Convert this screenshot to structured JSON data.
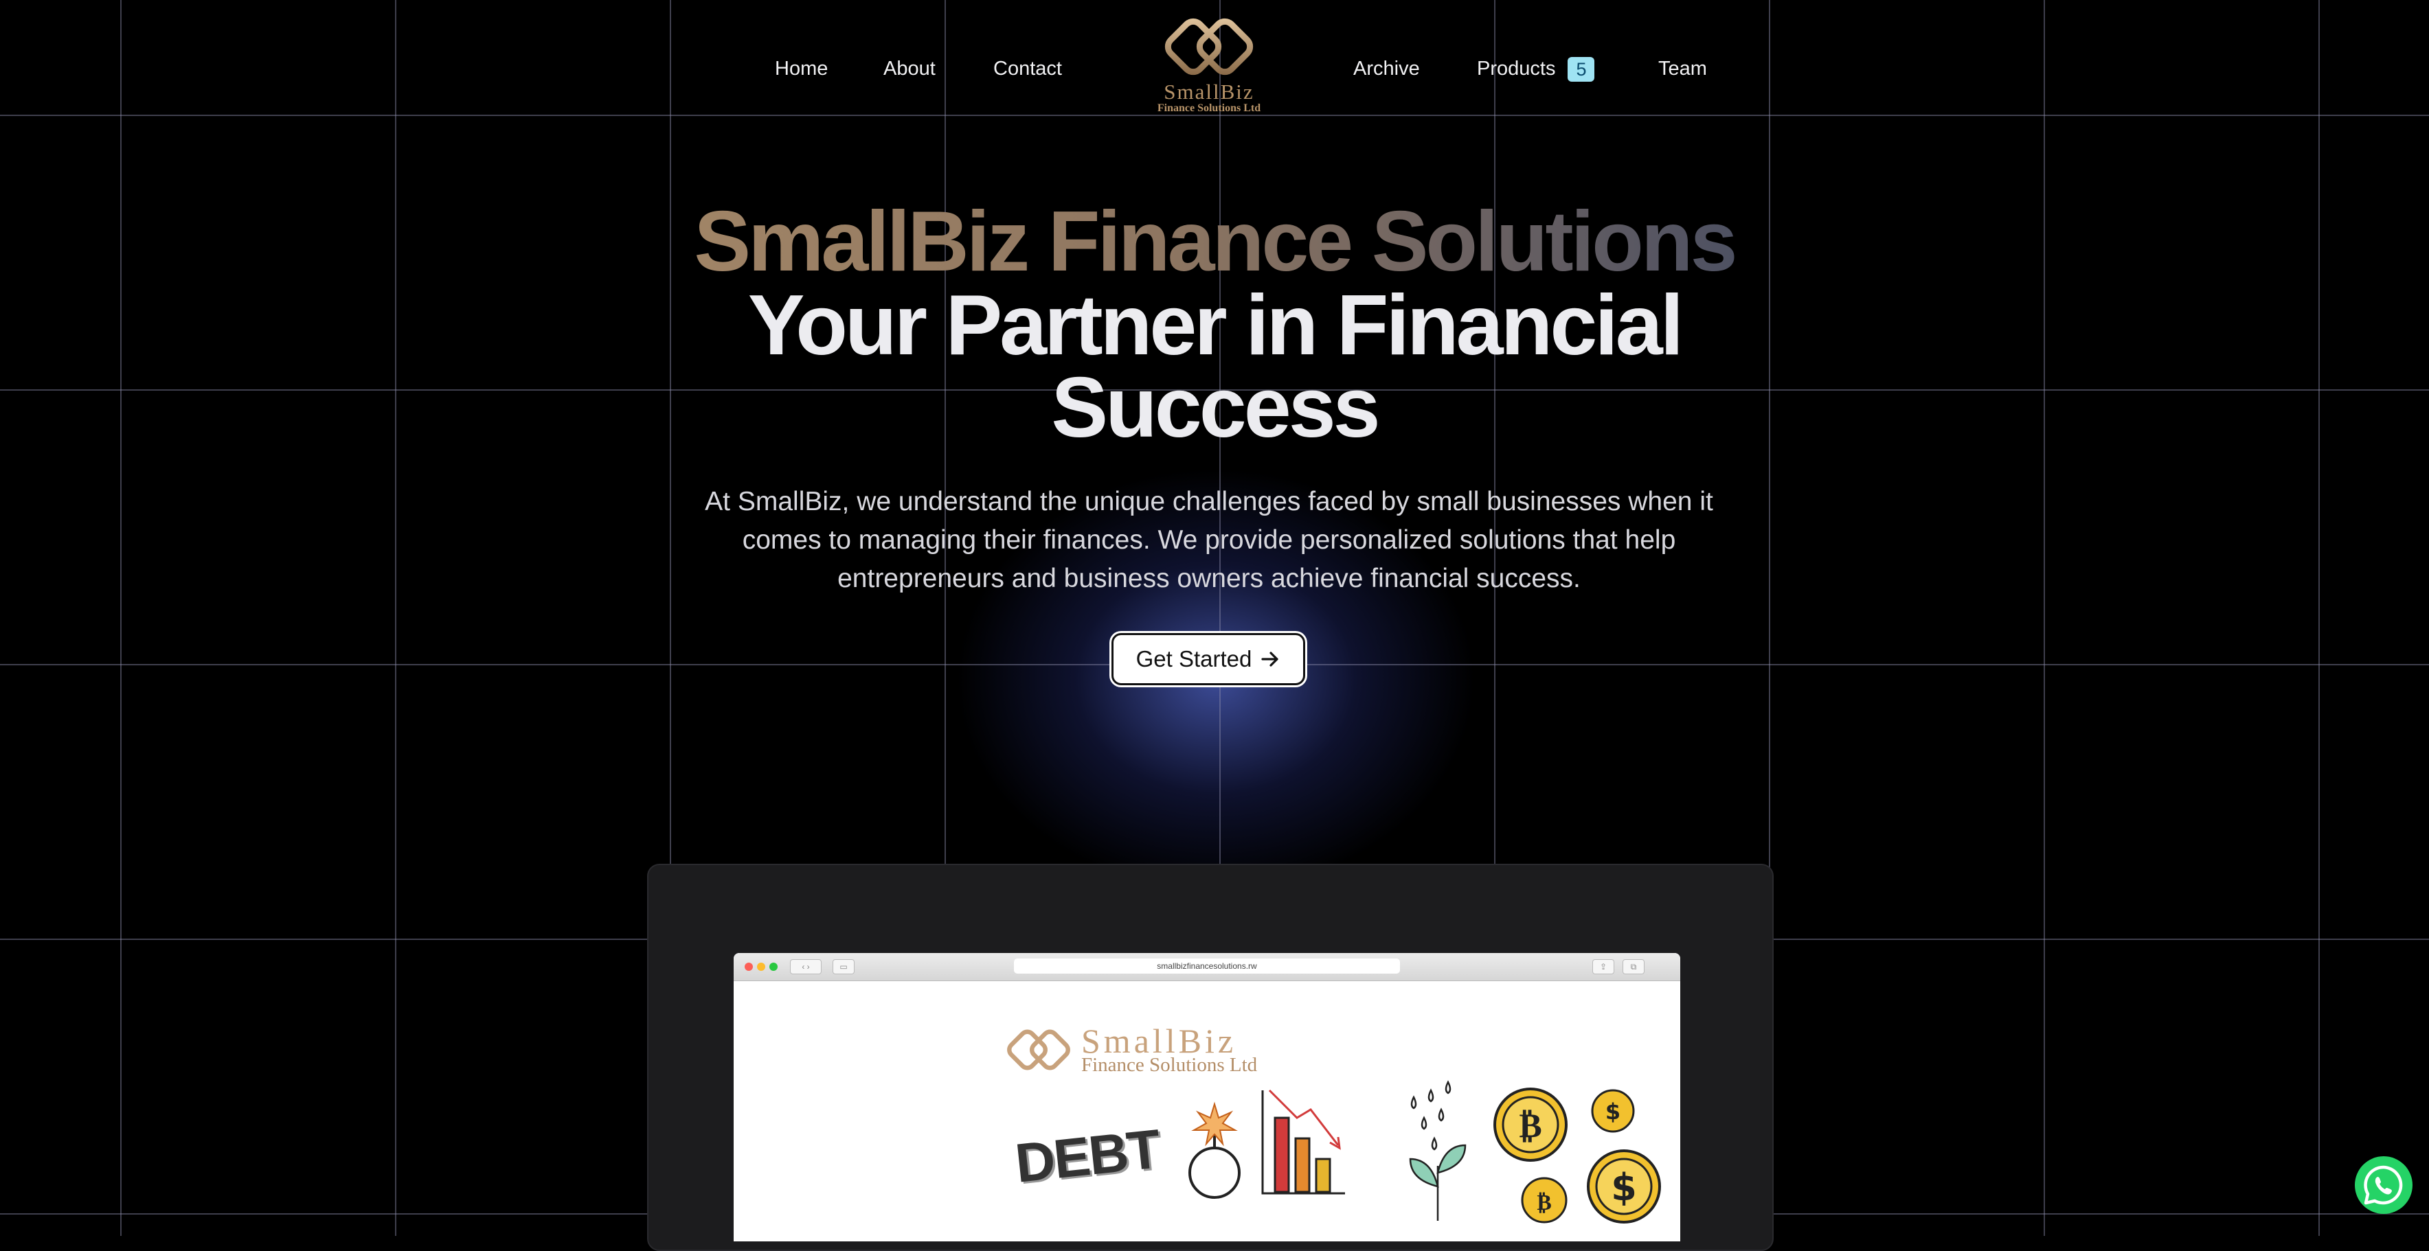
{
  "nav": {
    "left_items": [
      {
        "label": "Home"
      },
      {
        "label": "About"
      },
      {
        "label": "Contact"
      }
    ],
    "right_items": [
      {
        "label": "Archive"
      },
      {
        "label": "Products",
        "badge": "5"
      },
      {
        "label": "Team"
      }
    ],
    "logo": {
      "name": "SmallBiz",
      "subtitle": "Finance Solutions Ltd"
    }
  },
  "hero": {
    "brand": "SmallBiz Finance Solutions",
    "tagline": "Your Partner in Financial Success",
    "description": "At SmallBiz, we understand the unique challenges faced by small businesses when it comes to managing their finances. We provide personalized solutions that help entrepreneurs and business owners achieve financial success.",
    "cta_label": "Get Started",
    "cta_icon": "arrow-right-icon"
  },
  "preview": {
    "url": "smallbizfinancesolutions.rw",
    "logo_name": "SmallBiz",
    "logo_subtitle": "Finance Solutions Ltd",
    "debt_text": "DEBT"
  },
  "colors": {
    "background": "#000000",
    "brand_gold": "#b89469",
    "badge_bg": "#9fe3f3",
    "whatsapp": "#25d366",
    "glow": "#5064c8"
  },
  "floating": {
    "whatsapp_icon": "whatsapp-icon"
  }
}
